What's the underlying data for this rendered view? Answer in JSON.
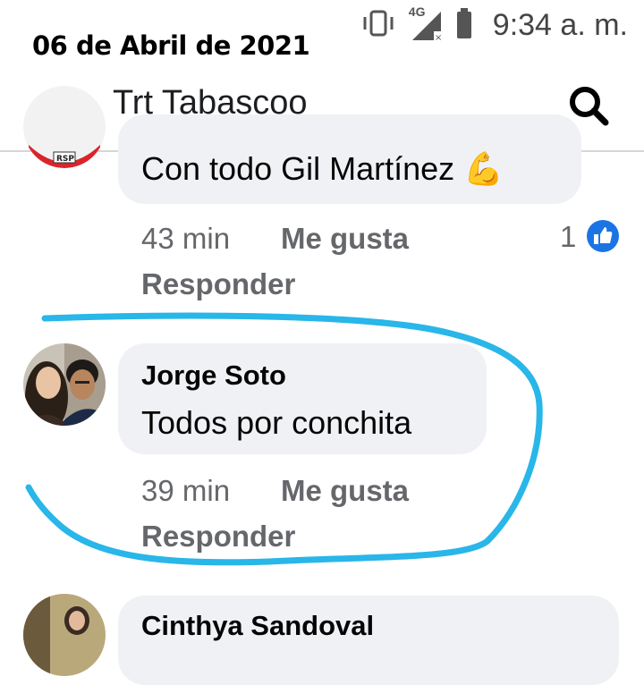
{
  "status": {
    "date_overlay": "06 de Abril de 2021",
    "time": "9:34 a. m.",
    "network_label": "4G",
    "icons": [
      "vibrate-icon",
      "signal-icon",
      "battery-icon"
    ]
  },
  "header": {
    "title": "Trt Tabascoo",
    "back_icon": "arrow-left-icon",
    "search_icon": "search-icon"
  },
  "comments": [
    {
      "text": "Con todo Gil Martínez",
      "emoji": "💪",
      "time": "43 min",
      "like_label": "Me gusta",
      "reply_label": "Responder",
      "reactions": "1"
    },
    {
      "name": "Jorge Soto",
      "text": "Todos por conchita",
      "time": "39 min",
      "like_label": "Me gusta",
      "reply_label": "Responder"
    },
    {
      "name": "Cinthya Sandoval"
    }
  ],
  "colors": {
    "annotation_stroke": "#29b6e8",
    "like_badge": "#1b74e4",
    "bubble_bg": "#eff1f4"
  }
}
